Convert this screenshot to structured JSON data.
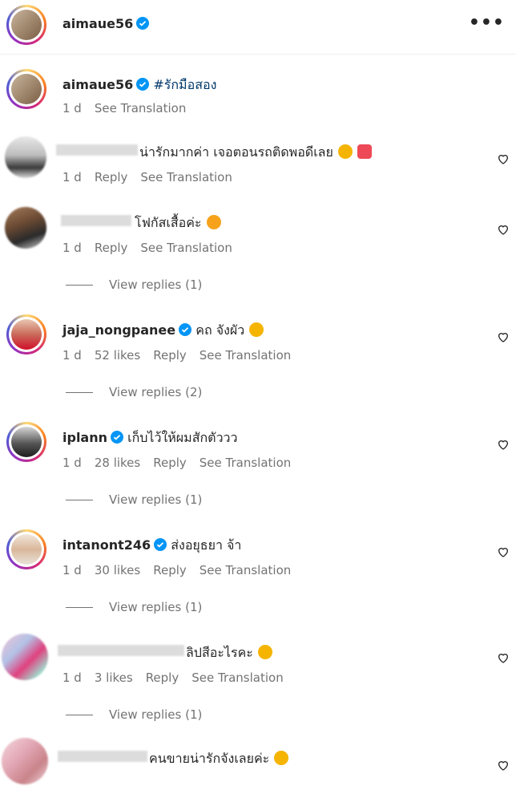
{
  "header": {
    "username": "aimaue56",
    "more_label": "•••"
  },
  "caption": {
    "username": "aimaue56",
    "hashtag": "#รักมือสอง",
    "time": "1 d",
    "see_translation": "See Translation"
  },
  "comments": [
    {
      "username": "",
      "text": "น่ารักมากค่า เจอตอนรถติดพอดีเลย",
      "time": "1 d",
      "likes": "",
      "reply": "Reply",
      "see_translation": "See Translation",
      "replies": ""
    },
    {
      "username": "",
      "text": "โฟกัสเสื้อค่ะ",
      "time": "1 d",
      "likes": "",
      "reply": "Reply",
      "see_translation": "See Translation",
      "replies": "View replies (1)"
    },
    {
      "username": "jaja_nongpanee",
      "text": "คถ จังผัว",
      "time": "1 d",
      "likes": "52 likes",
      "reply": "Reply",
      "see_translation": "See Translation",
      "replies": "View replies (2)"
    },
    {
      "username": "iplann",
      "text": "เก็บไว้ให้ผมสักตัววว",
      "time": "1 d",
      "likes": "28 likes",
      "reply": "Reply",
      "see_translation": "See Translation",
      "replies": "View replies (1)"
    },
    {
      "username": "intanont246",
      "text": "ส่งอยุธยา จ้า",
      "time": "1 d",
      "likes": "30 likes",
      "reply": "Reply",
      "see_translation": "See Translation",
      "replies": "View replies (1)"
    },
    {
      "username": "",
      "text": "ลิปสีอะไรคะ",
      "time": "1 d",
      "likes": "3 likes",
      "reply": "Reply",
      "see_translation": "See Translation",
      "replies": "View replies (1)"
    },
    {
      "username": "",
      "text": "คนขายน่ารักจังเลยค่ะ",
      "time": "",
      "likes": "",
      "reply": "",
      "see_translation": "",
      "replies": ""
    }
  ],
  "colors": {
    "verified": "#0095f6",
    "heart_emoji": "#ed4956",
    "meta": "#737373"
  }
}
